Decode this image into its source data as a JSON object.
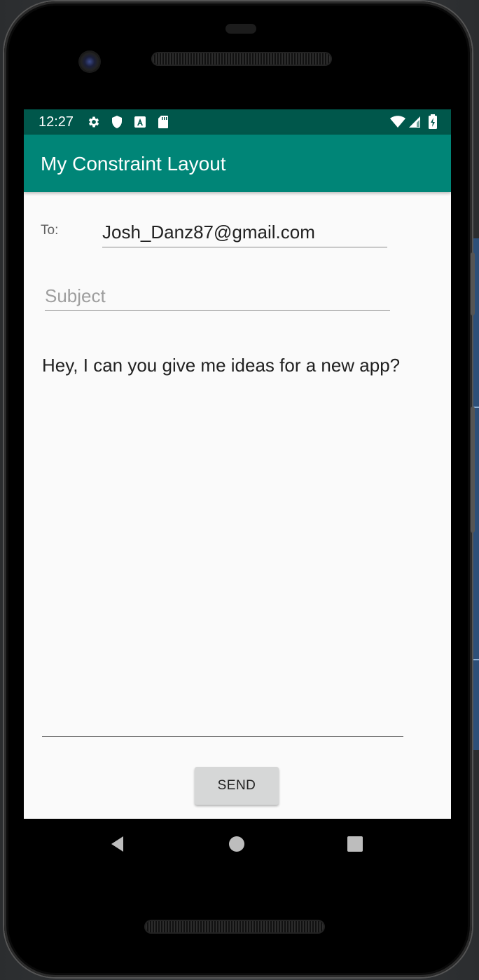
{
  "status_bar": {
    "time": "12:27",
    "icons": [
      "gear-icon",
      "shield-icon",
      "font-a-icon",
      "sd-card-icon",
      "wifi-icon",
      "signal-icon",
      "battery-charging-icon"
    ],
    "background_color": "#00574b"
  },
  "app_bar": {
    "title": "My Constraint Layout",
    "background_color": "#008577"
  },
  "form": {
    "to_label": "To:",
    "to_value": "Josh_Danz87@gmail.com",
    "subject_placeholder": "Subject",
    "subject_value": "",
    "message_value": "Hey, I can you give me ideas for a new app?",
    "send_label": "SEND"
  },
  "nav_bar": {
    "buttons": [
      "back-icon",
      "home-icon",
      "recents-icon"
    ]
  }
}
